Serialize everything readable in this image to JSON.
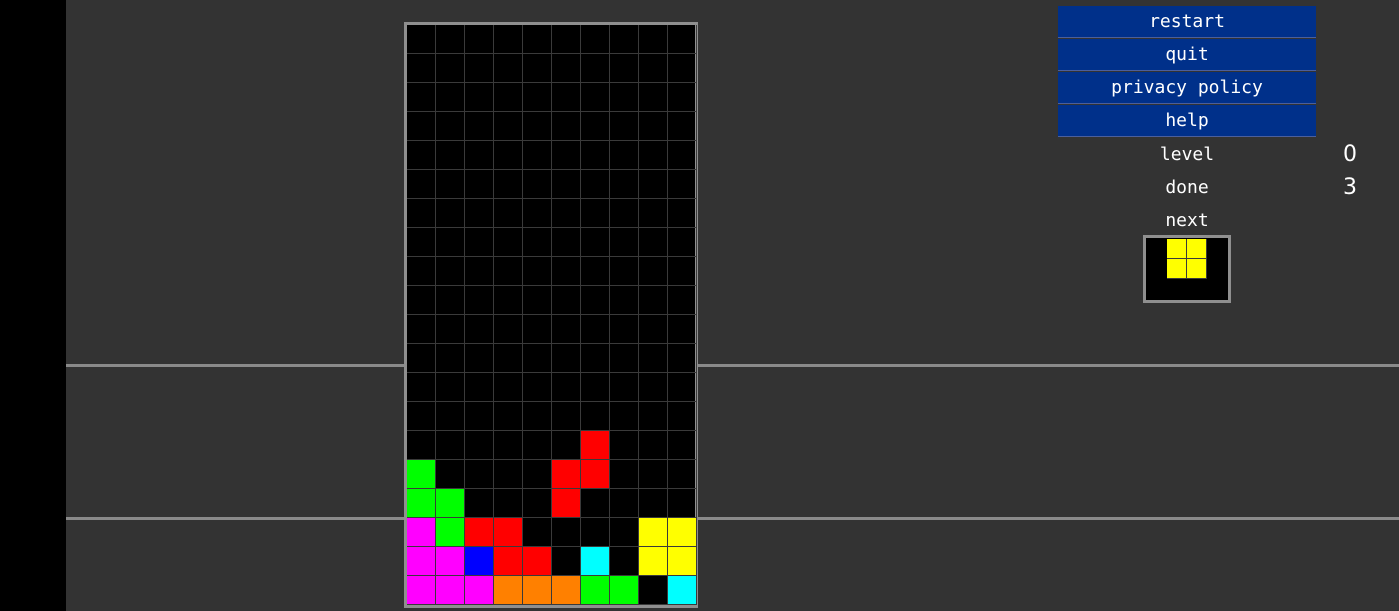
{
  "menu": {
    "restart": "restart",
    "quit": "quit",
    "privacy_policy": "privacy policy",
    "help": "help"
  },
  "stats": {
    "level_label": "level",
    "level_value": "0",
    "done_label": "done",
    "done_value": "3",
    "next_label": "next"
  },
  "colors": {
    "G": "#00ff00",
    "R": "#ff0000",
    "M": "#ff00ff",
    "B": "#0000ff",
    "C": "#00ffff",
    "O": "#ff8000",
    "Y": "#ffff00"
  },
  "board": {
    "cols": 10,
    "rows": 20,
    "grid": [
      "..........",
      "..........",
      "..........",
      "..........",
      "..........",
      "..........",
      "..........",
      "..........",
      "..........",
      "..........",
      "..........",
      "..........",
      "..........",
      "..........",
      "......R...",
      "G....RR...",
      "GG...R....",
      "MGRR....YY",
      "MMBRR.C.YY",
      "MMMOOOGG.C"
    ]
  },
  "next_piece": {
    "name": "O",
    "grid": [
      "YY",
      "YY"
    ]
  }
}
